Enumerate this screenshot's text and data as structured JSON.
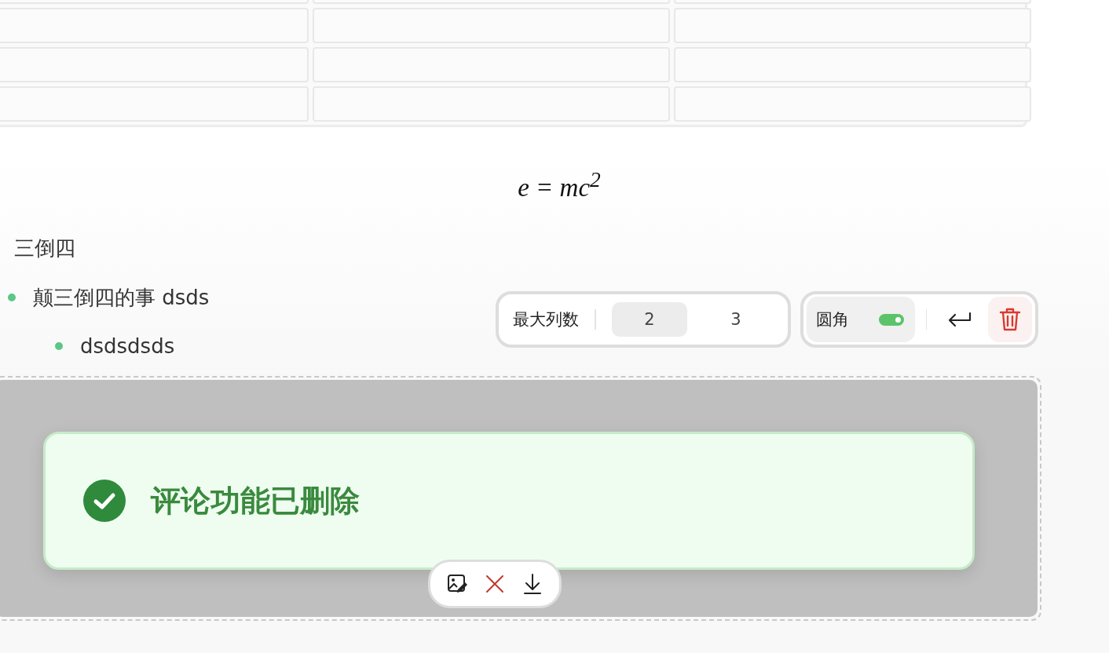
{
  "table": {
    "rows": [
      {
        "cells": [
          {
            "kind": "empty"
          },
          {
            "kind": "empty"
          },
          {
            "kind": "empty"
          }
        ]
      },
      {
        "cells": [
          {
            "kind": "empty"
          },
          {
            "kind": "empty"
          },
          {
            "kind": "empty"
          }
        ]
      },
      {
        "cells": [
          {
            "kind": "empty"
          },
          {
            "kind": "empty"
          },
          {
            "kind": "empty"
          }
        ]
      },
      {
        "cells": [
          {
            "kind": "empty"
          },
          {
            "kind": "empty"
          },
          {
            "kind": "empty"
          }
        ]
      }
    ]
  },
  "formula": "e = mc$^{2}$",
  "paragraph": "三倒四",
  "list": [
    {
      "text": "颠三倒四的事 dsds",
      "children": [
        {
          "text": "dsdsdsds"
        }
      ]
    }
  ],
  "block_toolbar": {
    "columns_label": "最大列数",
    "column_options": [
      {
        "label": "2",
        "selected": true
      },
      {
        "label": "3",
        "selected": false
      }
    ],
    "rounded": {
      "label": "圆角",
      "on": true
    }
  },
  "image": {
    "kind": "screenshot",
    "toast": {
      "message": "评论功能已删除"
    }
  }
}
